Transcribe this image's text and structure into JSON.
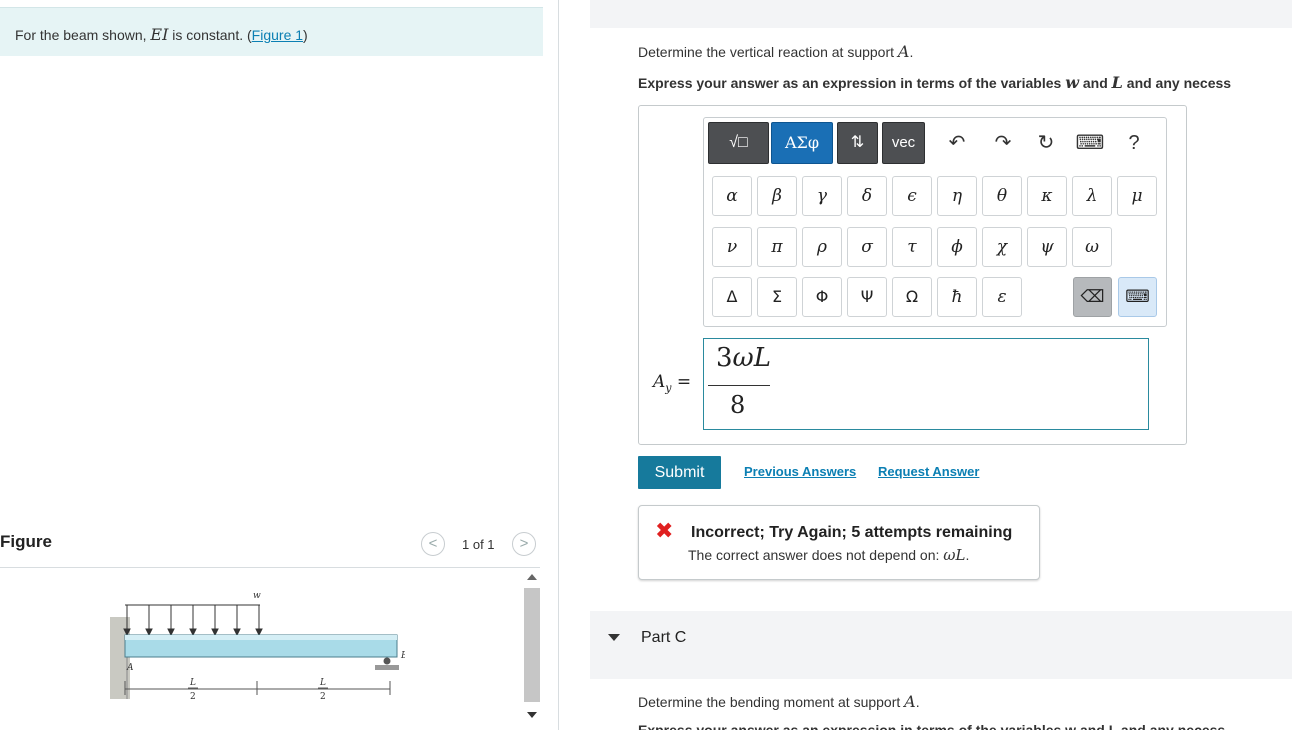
{
  "problem": {
    "text_before": "For the beam shown, ",
    "var": "EI",
    "text_after": " is constant. (",
    "figure_link": "Figure 1",
    "text_close": ")"
  },
  "figure_panel": {
    "title": "Figure",
    "pager": "1 of 1",
    "prev": "<",
    "next": ">",
    "labels": {
      "w": "w",
      "A": "A",
      "B": "B",
      "L": "L",
      "two": "2"
    }
  },
  "part_b": {
    "question_before": "Determine the vertical reaction at support ",
    "question_var": "A",
    "question_after": ".",
    "instruction_1": "Express your answer as an expression in terms of the variables ",
    "instruction_var1": "w",
    "instruction_and": " and ",
    "instruction_var2": "L",
    "instruction_2": " and any necess",
    "lhs_var": "A",
    "lhs_sub": "y",
    "lhs_eq": " =",
    "numerator_coef": "3",
    "numerator_var": "ωL",
    "denominator": "8",
    "submit": "Submit",
    "previous_answers": "Previous Answers",
    "request_answer": "Request Answer",
    "feedback_title": "Incorrect; Try Again; 5 attempts remaining",
    "feedback_text": "The correct answer does not depend on: ",
    "feedback_var": "ωL",
    "feedback_end": "."
  },
  "toolbar": {
    "templates": "√□",
    "greek": "ΑΣφ",
    "arrows": "⇅",
    "vec": "vec",
    "undo": "↶",
    "redo": "↷",
    "reset": "↻",
    "keyboard": "⌨",
    "help": "?"
  },
  "palette": {
    "row1": [
      "α",
      "β",
      "γ",
      "δ",
      "ϵ",
      "η",
      "θ",
      "κ",
      "λ",
      "μ"
    ],
    "row2": [
      "ν",
      "π",
      "ρ",
      "σ",
      "τ",
      "ϕ",
      "χ",
      "ψ",
      "ω"
    ],
    "row3": [
      "Δ",
      "Σ",
      "Φ",
      "Ψ",
      "Ω",
      "ħ",
      "ε"
    ],
    "backspace": "⌫",
    "keyboard": "⌨"
  },
  "part_c": {
    "label": "Part C",
    "question_before": "Determine the bending moment at support ",
    "question_var": "A",
    "question_after": ".",
    "instruction_partial": "Express your answer as an expression in terms of the variables w and L and any necess"
  },
  "colors": {
    "accent": "#167a9c",
    "link": "#0b7fb3",
    "greek_button": "#1a6fb5",
    "error": "#e02020"
  }
}
